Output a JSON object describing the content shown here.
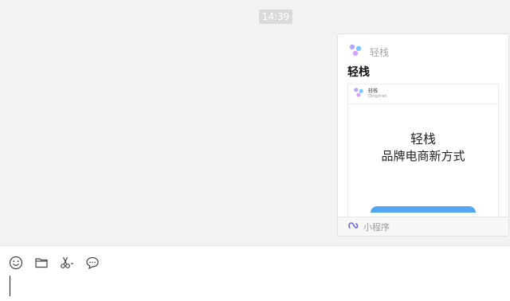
{
  "chat": {
    "timestamp": "14:39",
    "card": {
      "app_name": "轻栈",
      "title": "轻栈",
      "preview": {
        "mini_title": "轻栈",
        "mini_subtitle": "Qingzhan",
        "headline": "轻栈",
        "slogan": "品牌电商新方式"
      },
      "footer_label": "小程序"
    }
  },
  "toolbar": {
    "icons": [
      "emoji-icon",
      "folder-icon",
      "scissors-icon",
      "chat-bubble-icon"
    ]
  },
  "colors": {
    "background": "#f2f2f2",
    "accent": "#53a7f0"
  }
}
